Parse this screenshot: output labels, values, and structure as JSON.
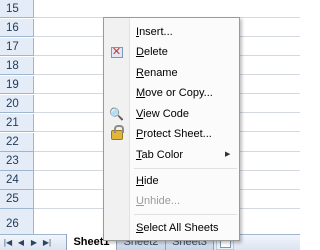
{
  "grid": {
    "rows": [
      "15",
      "16",
      "17",
      "18",
      "19",
      "20",
      "21",
      "22",
      "23",
      "24",
      "25",
      "26"
    ]
  },
  "sheet_tabs": {
    "nav_icons": [
      "first-sheet-icon",
      "prev-sheet-icon",
      "next-sheet-icon",
      "last-sheet-icon"
    ],
    "tabs": [
      {
        "label": "Sheet1",
        "active": true
      },
      {
        "label": "Sheet2",
        "active": false
      },
      {
        "label": "Sheet3",
        "active": false
      }
    ],
    "new_sheet_icon": "insert-worksheet-icon"
  },
  "context_menu": {
    "items": [
      {
        "label": "Insert...",
        "icon": null,
        "enabled": true
      },
      {
        "label": "Delete",
        "icon": "delete-sheet-icon",
        "enabled": true
      },
      {
        "label": "Rename",
        "icon": null,
        "enabled": true
      },
      {
        "label": "Move or Copy...",
        "icon": null,
        "enabled": true
      },
      {
        "label": "View Code",
        "icon": "view-code-icon",
        "enabled": true
      },
      {
        "label": "Protect Sheet...",
        "icon": "protect-sheet-icon",
        "enabled": true
      },
      {
        "label": "Tab Color",
        "icon": null,
        "enabled": true,
        "submenu": true
      },
      {
        "label": "Hide",
        "icon": null,
        "enabled": true
      },
      {
        "label": "Unhide...",
        "icon": null,
        "enabled": false
      },
      {
        "label": "Select All Sheets",
        "icon": null,
        "enabled": true
      }
    ]
  },
  "colors": {
    "row_header_bg": "#e4ecf7",
    "row_header_text": "#233b5a",
    "menu_bg": "#fbfbfb",
    "disabled_text": "#9b9b9b"
  }
}
